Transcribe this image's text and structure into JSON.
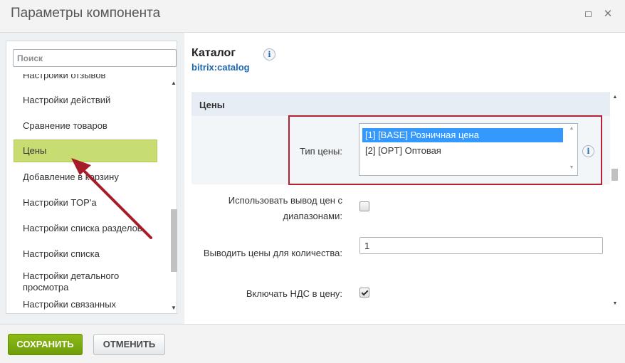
{
  "window": {
    "title": "Параметры компонента"
  },
  "sidebar": {
    "search_placeholder": "Поиск",
    "items": [
      {
        "label": "Настройки отзывов"
      },
      {
        "label": "Настройки действий"
      },
      {
        "label": "Сравнение товаров"
      },
      {
        "label": "Цены"
      },
      {
        "label": "Добавление в корзину"
      },
      {
        "label": "Настройки TOP'а"
      },
      {
        "label": "Настройки списка разделов"
      },
      {
        "label": "Настройки списка"
      },
      {
        "label": "Настройки детального просмотра"
      },
      {
        "label": "Настройки связанных"
      }
    ],
    "selected": "Цены"
  },
  "component": {
    "title": "Каталог",
    "code": "bitrix:catalog",
    "info_glyph": "i"
  },
  "section": {
    "title": "Цены",
    "price_type": {
      "label": "Тип цены:",
      "options": [
        "[1] [BASE] Розничная цена",
        "[2] [OPT] Оптовая"
      ],
      "selected": "[1] [BASE] Розничная цена",
      "info_glyph": "i"
    },
    "use_ranges": {
      "label": "Использовать вывод цен с диапазонами:",
      "checked": false
    },
    "quantity": {
      "label": "Выводить цены для количества:",
      "value": "1"
    },
    "vat": {
      "label": "Включать НДС в цену:",
      "checked": true
    }
  },
  "footer": {
    "save_label": "СОХРАНИТЬ",
    "cancel_label": "ОТМЕНИТЬ"
  },
  "colors": {
    "active_item": "#c8dd71",
    "highlight_border": "#b52131",
    "annotation_arrow": "#a61c28",
    "save_button": "#7aaa10",
    "link": "#2067b0",
    "selected_option": "#3399ff"
  },
  "icons": [
    "maximize-icon",
    "close-icon",
    "info-icon",
    "scroll-up-icon",
    "scroll-down-icon",
    "checkmark-icon",
    "annotation-arrow"
  ]
}
